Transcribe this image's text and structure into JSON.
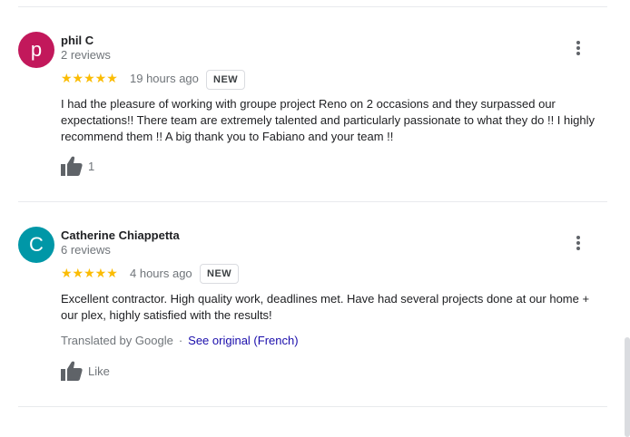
{
  "reviews": [
    {
      "avatar_letter": "p",
      "avatar_color": "#c2185b",
      "author": "phil C",
      "review_count": "2 reviews",
      "stars": "★★★★★",
      "time": "19 hours ago",
      "badge": "NEW",
      "text": "I had the pleasure of working with groupe project Reno on 2 occasions and they surpassed our expectations!! There team are extremely talented and particularly passionate to what they do !! I highly recommend them !! A big thank you to Fabiano and your team !!",
      "like_label": "1"
    },
    {
      "avatar_letter": "C",
      "avatar_color": "#0097a7",
      "author": "Catherine Chiappetta",
      "review_count": "6 reviews",
      "stars": "★★★★★",
      "time": "4 hours ago",
      "badge": "NEW",
      "text": "Excellent contractor. High quality work, deadlines met. Have had several projects done at our home + our plex, highly satisfied with the results!",
      "translated_by": "Translated by Google",
      "separator": "·",
      "see_original": "See original (French)",
      "like_label": "Like"
    }
  ],
  "star_color": "#fbbc04",
  "link_color": "#1a0dab"
}
